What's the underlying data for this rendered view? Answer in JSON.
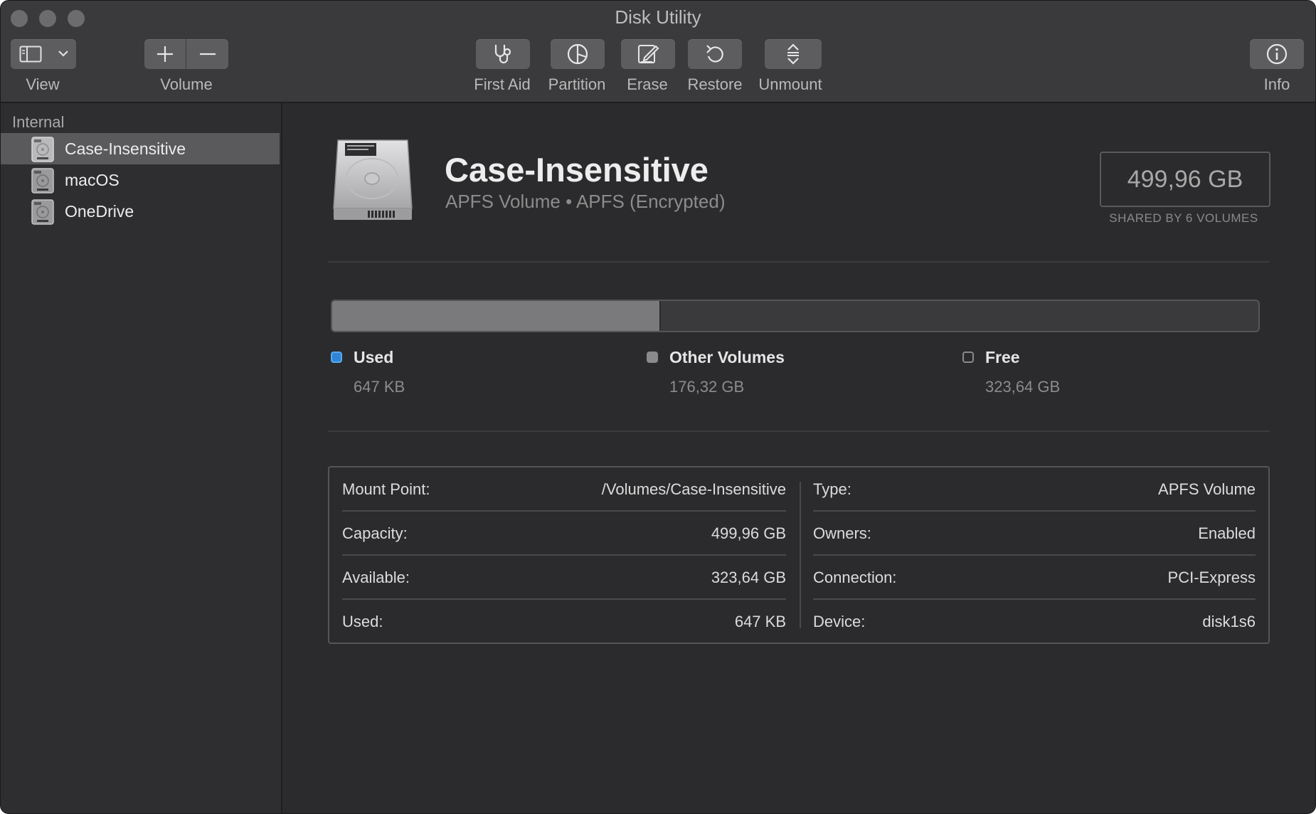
{
  "window": {
    "title": "Disk Utility"
  },
  "toolbar": {
    "view_label": "View",
    "volume_label": "Volume",
    "first_aid_label": "First Aid",
    "partition_label": "Partition",
    "erase_label": "Erase",
    "restore_label": "Restore",
    "unmount_label": "Unmount",
    "info_label": "Info"
  },
  "sidebar": {
    "header": "Internal",
    "items": [
      {
        "label": "Case-Insensitive",
        "selected": true
      },
      {
        "label": "macOS",
        "selected": false
      },
      {
        "label": "OneDrive",
        "selected": false
      }
    ]
  },
  "volume": {
    "name": "Case-Insensitive",
    "subtitle": "APFS Volume • APFS (Encrypted)",
    "capacity": "499,96 GB",
    "capacity_caption": "SHARED BY 6 VOLUMES"
  },
  "usage": {
    "filled_fraction": 0.353,
    "legend": [
      {
        "title": "Used",
        "value": "647 KB",
        "color": "#2f86d6"
      },
      {
        "title": "Other Volumes",
        "value": "176,32 GB",
        "color": "#8a8a8a"
      },
      {
        "title": "Free",
        "value": "323,64 GB",
        "color": "#2b2b2d"
      }
    ]
  },
  "info": {
    "left": [
      {
        "key": "Mount Point:",
        "value": "/Volumes/Case-Insensitive"
      },
      {
        "key": "Capacity:",
        "value": "499,96 GB"
      },
      {
        "key": "Available:",
        "value": "323,64 GB"
      },
      {
        "key": "Used:",
        "value": "647 KB"
      }
    ],
    "right": [
      {
        "key": "Type:",
        "value": "APFS Volume"
      },
      {
        "key": "Owners:",
        "value": "Enabled"
      },
      {
        "key": "Connection:",
        "value": "PCI-Express"
      },
      {
        "key": "Device:",
        "value": "disk1s6"
      }
    ]
  }
}
